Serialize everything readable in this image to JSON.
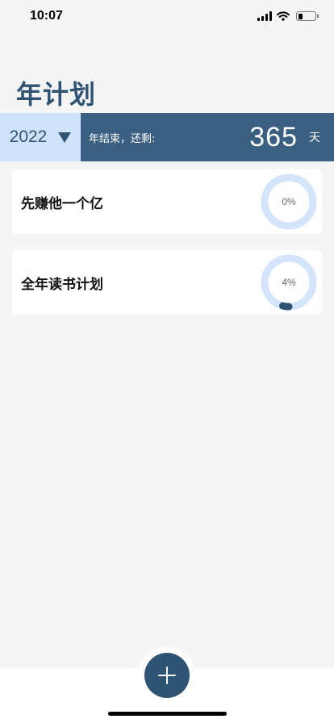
{
  "status_bar": {
    "time": "10:07",
    "icons": [
      "cellular-signal-icon",
      "wifi-icon",
      "battery-icon"
    ],
    "battery_level": 0.25
  },
  "header": {
    "title": "年计划"
  },
  "year_bar": {
    "year": "2022",
    "remaining_label": "年结束，还剩:",
    "remaining_days": "365",
    "remaining_unit": "天"
  },
  "plans": [
    {
      "name": "先赚他一个亿",
      "progress_text": "0%",
      "progress": 0
    },
    {
      "name": "全年读书计划",
      "progress_text": "4%",
      "progress": 0.04
    }
  ],
  "footer": {
    "add_icon": "plus-icon"
  },
  "colors": {
    "primary": "#2f5473",
    "panel": "#3a5f80",
    "light_accent": "#cfe2fa",
    "ring_track": "#d4e4fb",
    "background": "#f5f5f5"
  }
}
